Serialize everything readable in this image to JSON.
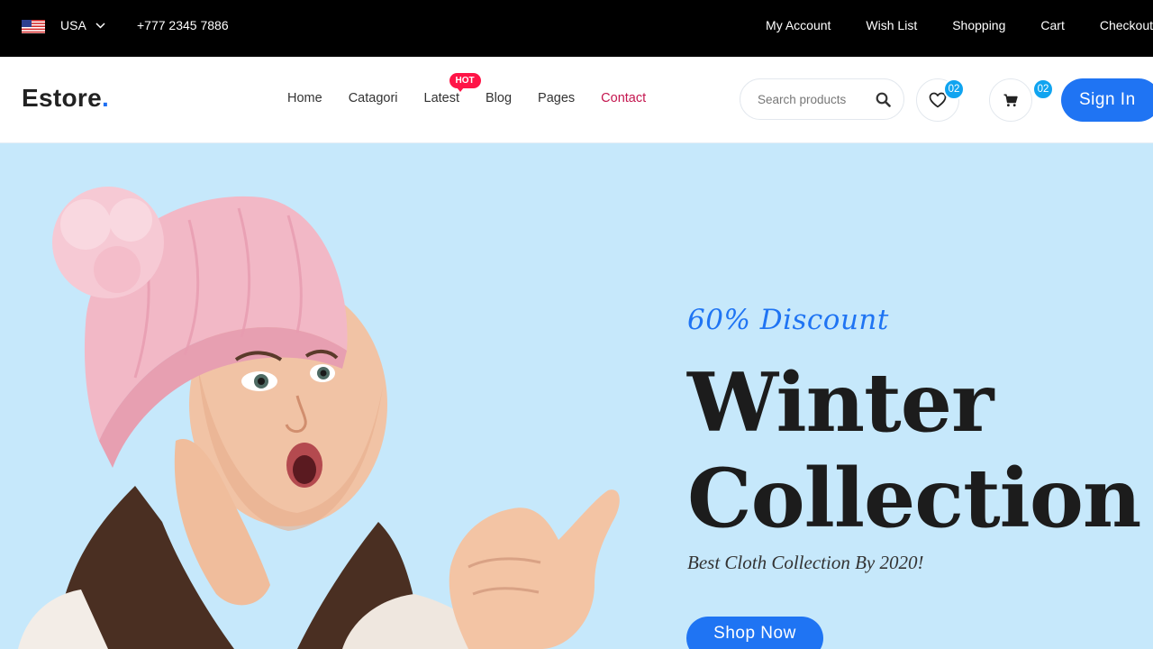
{
  "topbar": {
    "country": "USA",
    "flag_icon": "us-flag-icon",
    "phone": "+777 2345 7886",
    "links": [
      "My Account",
      "Wish List",
      "Shopping",
      "Cart",
      "Checkout"
    ]
  },
  "header": {
    "logo_text": "Estore",
    "logo_dot": ".",
    "nav": [
      {
        "label": "Home"
      },
      {
        "label": "Catagori"
      },
      {
        "label": "Latest",
        "badge": "HOT"
      },
      {
        "label": "Blog"
      },
      {
        "label": "Pages"
      },
      {
        "label": "Contact",
        "active": true
      }
    ],
    "search": {
      "placeholder": "Search products",
      "icon": "search-icon"
    },
    "wishlist": {
      "icon": "heart-icon",
      "count": "02"
    },
    "cart": {
      "icon": "cart-icon",
      "count": "02"
    },
    "signin_label": "Sign In"
  },
  "hero": {
    "discount": "60% Discount",
    "title_line1": "Winter",
    "title_line2": "Collection",
    "subtitle": "Best Cloth Collection By 2020!",
    "cta_label": "Shop Now",
    "background_color": "#c6e8fb"
  },
  "colors": {
    "accent": "#1f74f3",
    "badge": "#ff1447",
    "counter": "#10a4f0",
    "active_nav": "#c4164f"
  }
}
